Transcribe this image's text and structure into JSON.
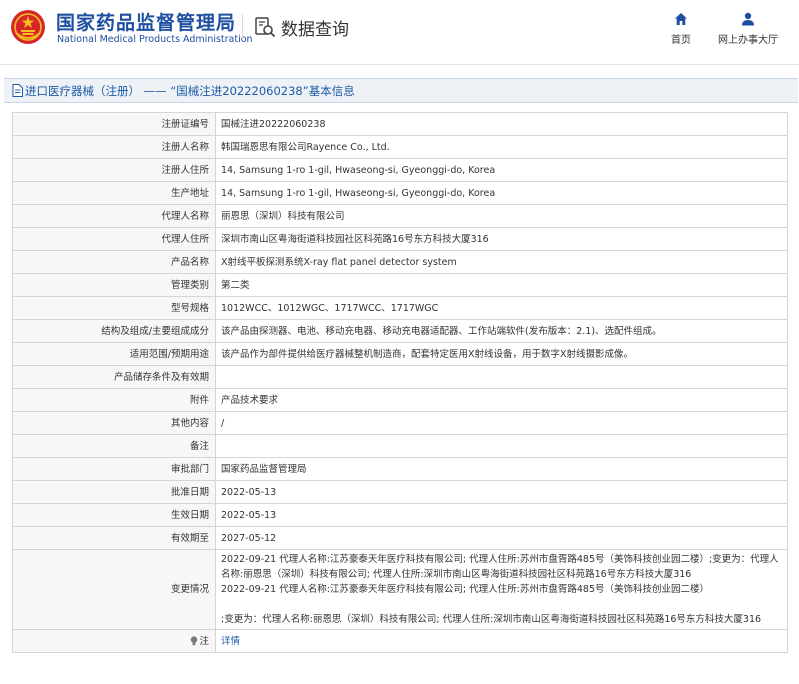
{
  "header": {
    "brand_cn": "国家药品监督管理局",
    "brand_en": "National Medical Products Administration",
    "query_label": "数据查询",
    "nav": {
      "home_label": "首页",
      "service_label": "网上办事大厅"
    }
  },
  "colors": {
    "brand_blue": "#1e4fa0",
    "link_blue": "#1a5aa8",
    "emblem_red": "#d7262b",
    "emblem_gold": "#f3c21a"
  },
  "icons": {
    "emblem": "national-emblem-icon",
    "query": "search-document-icon",
    "home": "home-icon",
    "service": "user-icon",
    "title": "document-icon",
    "note": "lightbulb-icon"
  },
  "title_bar": {
    "text": "进口医疗器械（注册） —— “国械注进20222060238”基本信息"
  },
  "rows": [
    {
      "label": "注册证编号",
      "value": "国械注进20222060238"
    },
    {
      "label": "注册人名称",
      "value": "韩国瑞恩思有限公司Rayence Co., Ltd."
    },
    {
      "label": "注册人住所",
      "value": "14, Samsung 1-ro 1-gil, Hwaseong-si, Gyeonggi-do, Korea"
    },
    {
      "label": "生产地址",
      "value": "14, Samsung 1-ro 1-gil, Hwaseong-si, Gyeonggi-do, Korea"
    },
    {
      "label": "代理人名称",
      "value": "丽恩思（深圳）科技有限公司"
    },
    {
      "label": "代理人住所",
      "value": "深圳市南山区粤海街道科技园社区科苑路16号东方科技大厦316"
    },
    {
      "label": "产品名称",
      "value": "X射线平板探测系统X-ray flat panel detector system"
    },
    {
      "label": "管理类别",
      "value": "第二类"
    },
    {
      "label": "型号规格",
      "value": "1012WCC、1012WGC、1717WCC、1717WGC"
    },
    {
      "label": "结构及组成/主要组成成分",
      "value": "该产品由探测器、电池、移动充电器、移动充电器适配器、工作站端软件(发布版本：2.1)、选配件组成。"
    },
    {
      "label": "适用范围/预期用途",
      "value": "该产品作为部件提供给医疗器械整机制造商，配套特定医用X射线设备，用于数字X射线摄影成像。"
    },
    {
      "label": "产品储存条件及有效期",
      "value": ""
    },
    {
      "label": "附件",
      "value": "产品技术要求"
    },
    {
      "label": "其他内容",
      "value": "/"
    },
    {
      "label": "备注",
      "value": ""
    },
    {
      "label": "审批部门",
      "value": "国家药品监督管理局"
    },
    {
      "label": "批准日期",
      "value": "2022-05-13"
    },
    {
      "label": "生效日期",
      "value": "2022-05-13"
    },
    {
      "label": "有效期至",
      "value": "2027-05-12"
    }
  ],
  "change": {
    "label": "变更情况",
    "line1": "2022-09-21 代理人名称:江苏豪泰天年医疗科技有限公司; 代理人住所:苏州市盘胥路485号（美饰科技创业园二楼）;变更为：代理人名称:丽恩思（深圳）科技有限公司; 代理人住所:深圳市南山区粤海街道科技园社区科苑路16号东方科技大厦316",
    "line2": "2022-09-21 代理人名称:江苏豪泰天年医疗科技有限公司; 代理人住所:苏州市盘胥路485号（美饰科技创业园二楼）",
    "line3": ";变更为：代理人名称:丽恩思（深圳）科技有限公司; 代理人住所:深圳市南山区粤海街道科技园社区科苑路16号东方科技大厦316"
  },
  "note": {
    "label": "注",
    "link": "详情"
  }
}
